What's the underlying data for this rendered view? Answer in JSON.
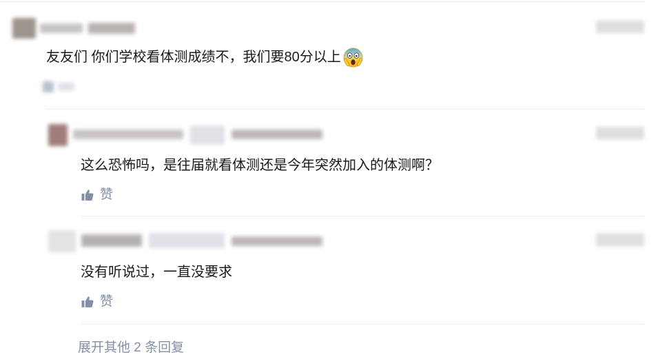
{
  "comment": {
    "text": "友友们 你们学校看体测成绩不，我们要80分以上",
    "emoji_icon": "face-screaming-in-fear"
  },
  "replies": [
    {
      "text": "这么恐怖吗，是往届就看体测还是今年突然加入的体测啊？",
      "like_label": "赞",
      "like_icon": "thumbs-up-icon"
    },
    {
      "text": "没有听说过，一直没要求",
      "like_label": "赞",
      "like_icon": "thumbs-up-icon"
    }
  ],
  "expand_more_label": "展开其他 2 条回复",
  "colors": {
    "text": "#1a1a1a",
    "muted": "#8590a6",
    "divider": "#ebebeb",
    "background": "#ffffff"
  }
}
